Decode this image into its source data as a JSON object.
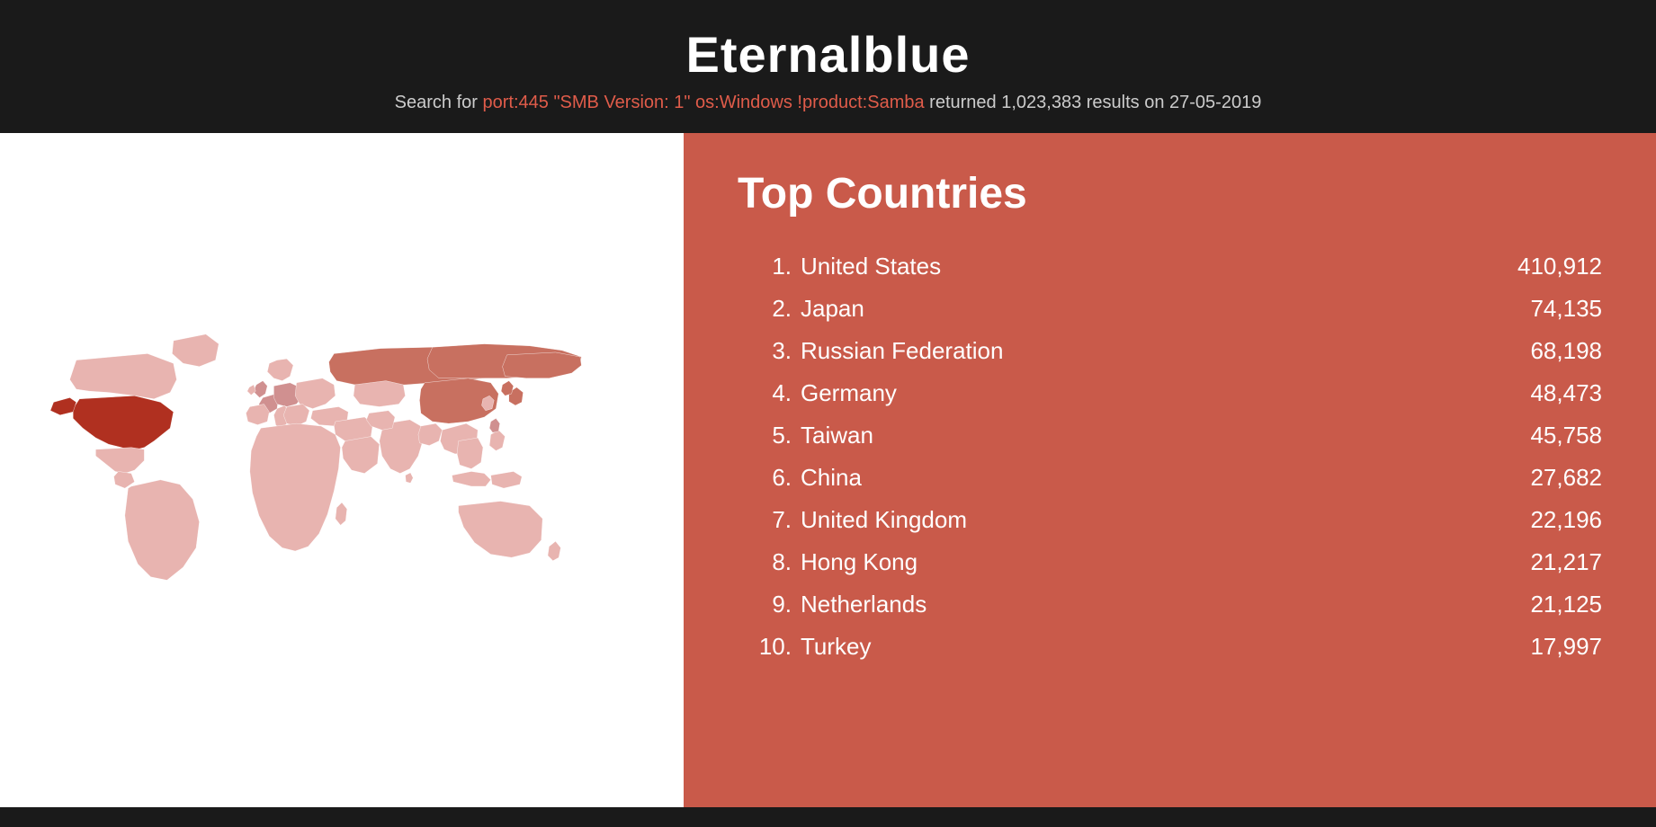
{
  "header": {
    "title": "Eternalblue",
    "description_prefix": "Search for ",
    "query": "port:445 \"SMB Version: 1\" os:Windows !product:Samba",
    "description_suffix": " returned 1,023,383 results on 27-05-2019"
  },
  "countries_section": {
    "heading": "Top Countries",
    "countries": [
      {
        "rank": "1.",
        "name": "United States",
        "count": "410,912"
      },
      {
        "rank": "2.",
        "name": "Japan",
        "count": "74,135"
      },
      {
        "rank": "3.",
        "name": "Russian Federation",
        "count": "68,198"
      },
      {
        "rank": "4.",
        "name": "Germany",
        "count": "48,473"
      },
      {
        "rank": "5.",
        "name": "Taiwan",
        "count": "45,758"
      },
      {
        "rank": "6.",
        "name": "China",
        "count": "27,682"
      },
      {
        "rank": "7.",
        "name": "United Kingdom",
        "count": "22,196"
      },
      {
        "rank": "8.",
        "name": "Hong Kong",
        "count": "21,217"
      },
      {
        "rank": "9.",
        "name": "Netherlands",
        "count": "21,125"
      },
      {
        "rank": "10.",
        "name": "Turkey",
        "count": "17,997"
      }
    ]
  }
}
